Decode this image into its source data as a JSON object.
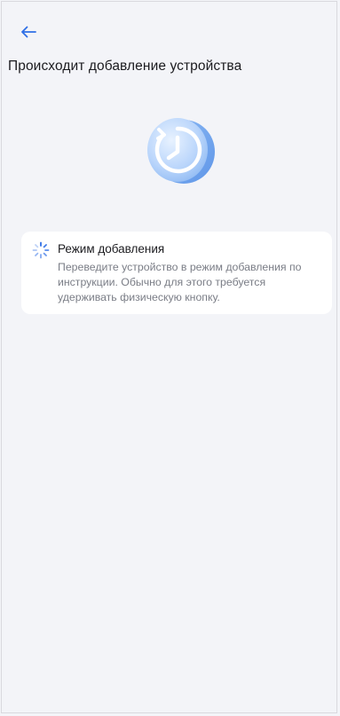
{
  "header": {
    "back_icon": "arrow-left-icon",
    "title": "Происходит добавление устройства"
  },
  "illustration": {
    "icon": "clock-refresh-icon"
  },
  "step": {
    "icon": "loading-spinner-icon",
    "title": "Режим добавления",
    "description": "Переведите устройство в режим добавления по инструкции. Обычно для этого требуется удерживать физическую кнопку."
  },
  "colors": {
    "accent": "#2f6fe6",
    "background": "#f3f4f8",
    "card": "#ffffff",
    "secondary_text": "#7a7d86"
  }
}
